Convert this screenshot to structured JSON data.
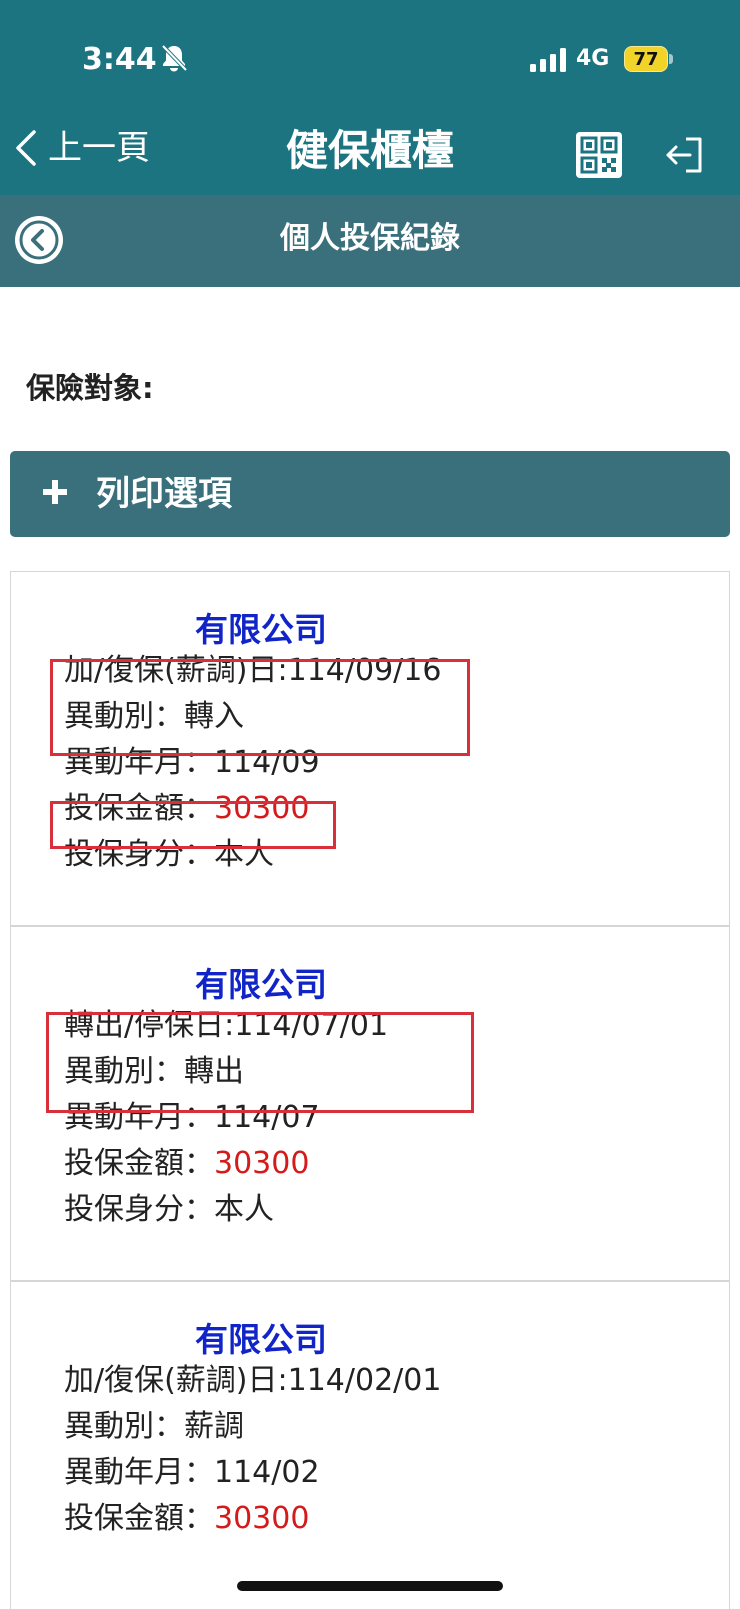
{
  "status_bar": {
    "time": "3:44",
    "network": "4G",
    "battery": "77"
  },
  "header": {
    "back_label": "上一頁",
    "title": "健保櫃檯"
  },
  "subheader": {
    "title": "個人投保紀錄"
  },
  "insured": {
    "label": "保險對象:"
  },
  "print_panel": {
    "label": "列印選項"
  },
  "records": [
    {
      "company": "有限公司",
      "date_line": "加/復保(薪調)日:114/09/16",
      "change_type": "異動別：轉入",
      "change_month": "異動年月：114/09",
      "amount_label": "投保金額：",
      "amount": "30300",
      "identity": "投保身分：本人"
    },
    {
      "company": "有限公司",
      "date_line": "轉出/停保日:114/07/01",
      "change_type": "異動別：轉出",
      "change_month": "異動年月：114/07",
      "amount_label": "投保金額：",
      "amount": "30300",
      "identity": "投保身分：本人"
    },
    {
      "company": "有限公司",
      "date_line": "加/復保(薪調)日:114/02/01",
      "change_type": "異動別：薪調",
      "change_month": "異動年月：114/02",
      "amount_label": "投保金額：",
      "amount": "30300"
    }
  ],
  "colors": {
    "header": "#1b7480",
    "panel": "#3a6f7c",
    "company": "#1024c8",
    "amount": "#d41a1a",
    "highlight": "#d8303a"
  }
}
